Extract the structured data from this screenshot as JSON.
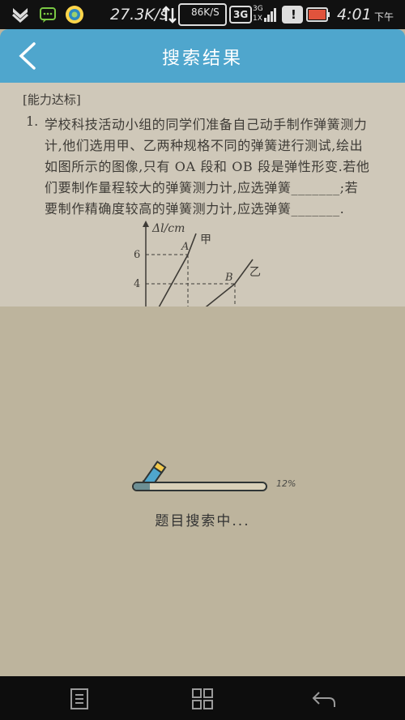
{
  "status_bar": {
    "speed": "27.3K/s",
    "speed2": "86K/S",
    "network": "3G",
    "net_small": "3G",
    "net_sim": "1X",
    "time": "4:01",
    "ampm": "下午"
  },
  "app_bar": {
    "title": "搜索结果",
    "back_icon": "chevron-left-icon"
  },
  "photo": {
    "section_tag": "[能力达标]",
    "question_number": "1.",
    "lines": [
      "学校科技活动小组的同学们准备自己动手制作弹簧测力",
      "计,他们选用甲、乙两种规格不同的弹簧进行测试,绘出",
      "如图所示的图像,只有 OA 段和 OB 段是弹性形变.若他",
      "们要制作量程较大的弹簧测力计,应选弹簧_______;若",
      "要制作精确度较高的弹簧测力计,应选弹簧_______."
    ],
    "graph": {
      "y_label": "Δl/cm",
      "tick_6": "6",
      "tick_4": "4",
      "point_a": "A",
      "point_b": "B",
      "series_jia": "甲",
      "series_yi": "乙"
    }
  },
  "loading": {
    "progress_label": "12%",
    "progress_value": 0.12,
    "message": "题目搜索中..."
  },
  "nav_bar": {
    "items": [
      "menu-icon",
      "home-icon",
      "back-icon"
    ]
  }
}
